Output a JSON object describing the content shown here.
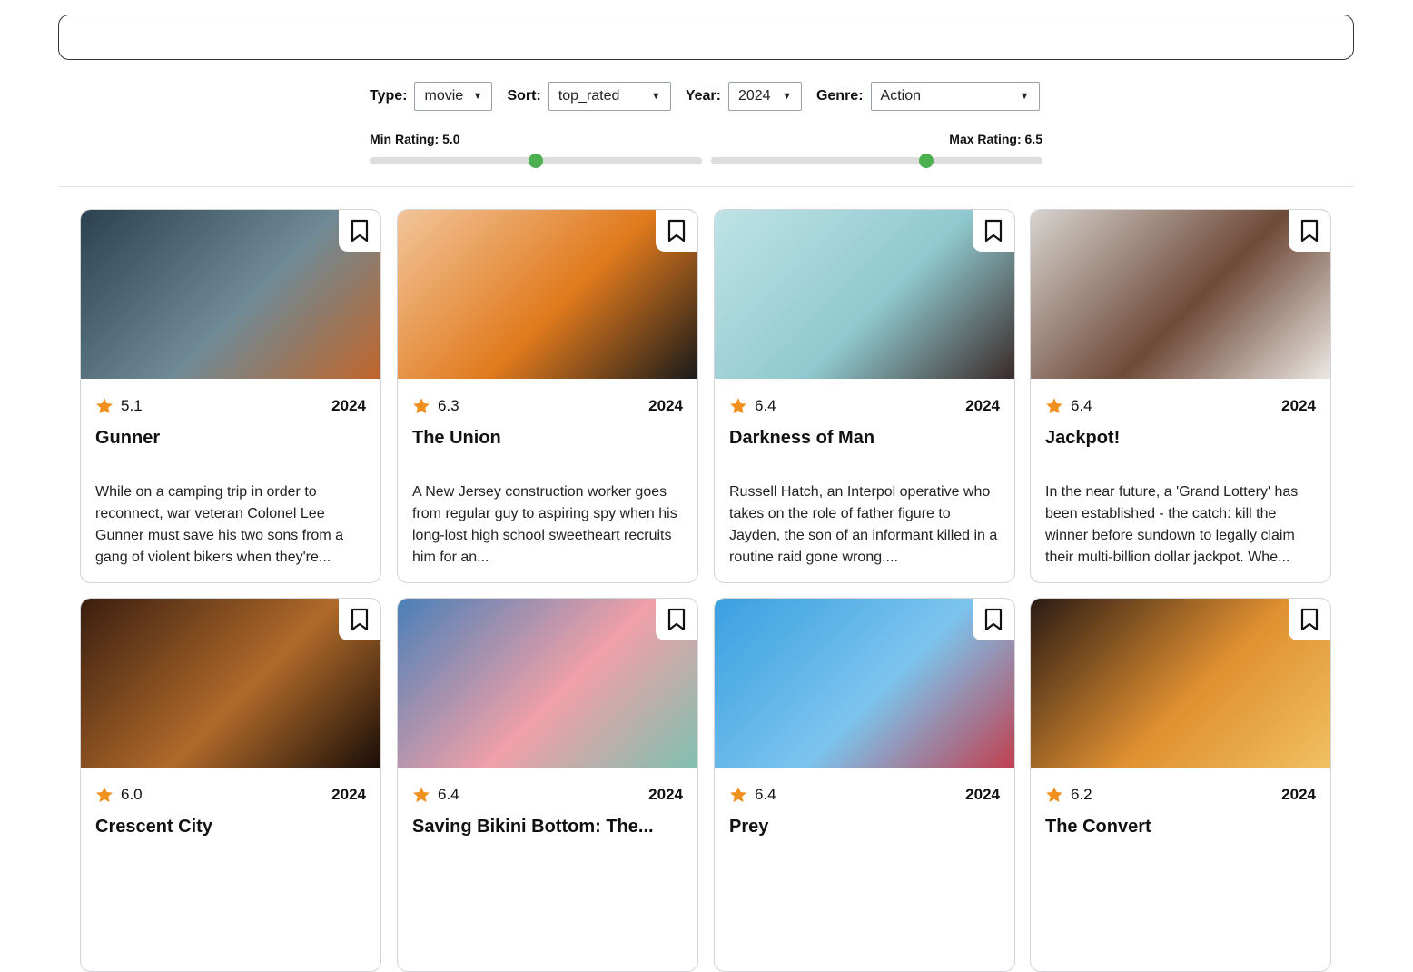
{
  "search": {
    "value": "",
    "placeholder": ""
  },
  "filters": {
    "type_label": "Type:",
    "type_value": "movie",
    "sort_label": "Sort:",
    "sort_value": "top_rated",
    "year_label": "Year:",
    "year_value": "2024",
    "genre_label": "Genre:",
    "genre_value": "Action",
    "min_rating_label": "Min Rating: 5.0",
    "min_rating": 5.0,
    "max_rating_label": "Max Rating: 6.5",
    "max_rating": 6.5,
    "slider_color": "#4caf50"
  },
  "star_color": "#f0901e",
  "cards": [
    {
      "rating": "5.1",
      "year": "2024",
      "title": "Gunner",
      "desc": "While on a camping trip in order to reconnect, war veteran Colonel Lee Gunner must save his two sons from a gang of violent bikers when they're...",
      "poster_colors": [
        "#2b4150",
        "#6f8a96",
        "#c0652a"
      ]
    },
    {
      "rating": "6.3",
      "year": "2024",
      "title": "The Union",
      "desc": "A New Jersey construction worker goes from regular guy to aspiring spy when his long-lost high school sweetheart recruits him for an...",
      "poster_colors": [
        "#f2c59a",
        "#e07a1c",
        "#1a1a1a"
      ]
    },
    {
      "rating": "6.4",
      "year": "2024",
      "title": "Darkness of Man",
      "desc": "Russell Hatch, an Interpol operative who takes on the role of father figure to Jayden, the son of an informant killed in a routine raid gone wrong....",
      "poster_colors": [
        "#bfe3e6",
        "#8fc9cf",
        "#3a2a28"
      ]
    },
    {
      "rating": "6.4",
      "year": "2024",
      "title": "Jackpot!",
      "desc": "In the near future, a 'Grand Lottery' has been established - the catch: kill the winner before sundown to legally claim their multi-billion dollar jackpot. Whe...",
      "poster_colors": [
        "#d8d4d0",
        "#6e4a38",
        "#ece8e4"
      ]
    },
    {
      "rating": "6.0",
      "year": "2024",
      "title": "Crescent City",
      "desc": "",
      "poster_colors": [
        "#3a1e10",
        "#b06a2a",
        "#1a0e08"
      ]
    },
    {
      "rating": "6.4",
      "year": "2024",
      "title": "Saving Bikini Bottom: The...",
      "desc": "",
      "poster_colors": [
        "#4a7fb8",
        "#f0a0a8",
        "#7fc0b0"
      ]
    },
    {
      "rating": "6.4",
      "year": "2024",
      "title": "Prey",
      "desc": "",
      "poster_colors": [
        "#3aa0e0",
        "#7cc4ee",
        "#c04050"
      ]
    },
    {
      "rating": "6.2",
      "year": "2024",
      "title": "The Convert",
      "desc": "",
      "poster_colors": [
        "#2a1a14",
        "#e09030",
        "#f0c060"
      ]
    }
  ]
}
